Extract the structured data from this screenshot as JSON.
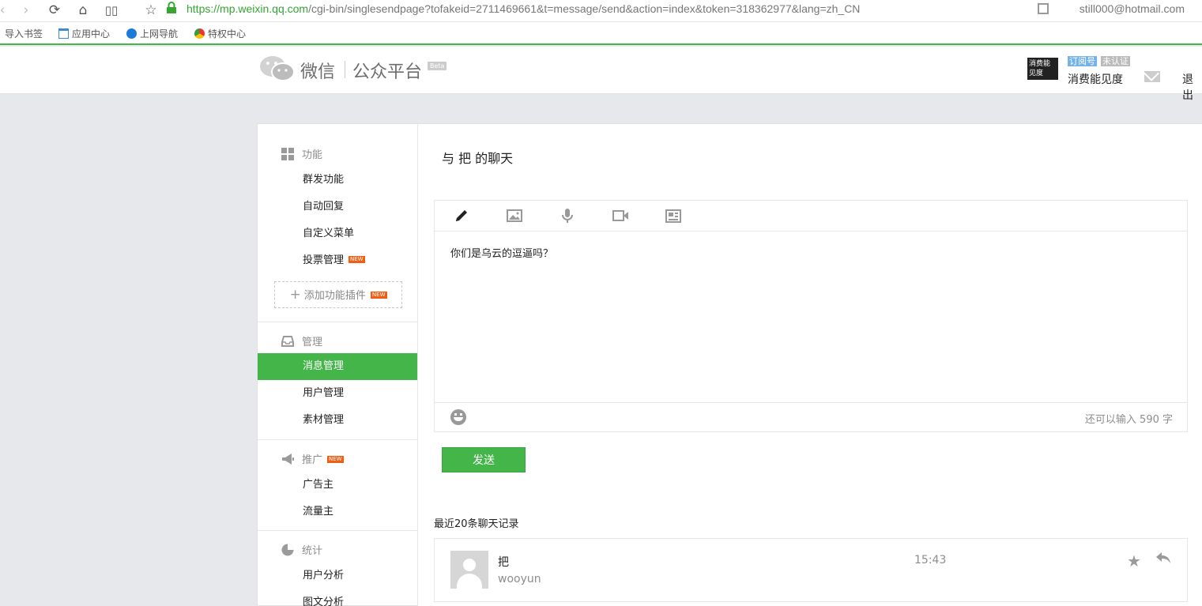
{
  "browser": {
    "url_https": "https://",
    "url_host": "mp.weixin.qq.com",
    "url_path": "/cgi-bin/singlesendpage?tofakeid=2711469661&t=message/send&action=index&token=318362977&lang=zh_CN",
    "account": "still000@hotmail.com",
    "bookmarks": [
      "导入书签",
      "应用中心",
      "上网导航",
      "特权中心"
    ]
  },
  "header": {
    "logo_text": "微信",
    "logo_sub": "公众平台",
    "beta": "Beta",
    "avatar_text": "消费能见度",
    "tag_type": "订阅号",
    "tag_status": "未认证",
    "account_name": "消费能见度",
    "logout": "退出"
  },
  "sidebar": {
    "features": {
      "title": "功能",
      "items": [
        "群发功能",
        "自动回复",
        "自定义菜单",
        "投票管理"
      ],
      "new_badge": "NEW",
      "add_plugin": "添加功能插件"
    },
    "manage": {
      "title": "管理",
      "items": [
        "消息管理",
        "用户管理",
        "素材管理"
      ]
    },
    "promote": {
      "title": "推广",
      "items": [
        "广告主",
        "流量主"
      ]
    },
    "stats": {
      "title": "统计",
      "items": [
        "用户分析",
        "图文分析"
      ]
    }
  },
  "main": {
    "chat_title": "与 把 的聊天",
    "tools": [
      "pencil-icon",
      "image-icon",
      "microphone-icon",
      "video-icon",
      "news-icon"
    ],
    "editor_text": "你们是乌云的逗逼吗？",
    "char_count": "还可以输入 590 字",
    "send_label": "发送",
    "history_title": "最近20条聊天记录",
    "history": [
      {
        "name": "把",
        "text": "wooyun",
        "time": "15:43"
      }
    ]
  },
  "colors": {
    "accent": "#44b549",
    "new_badge": "#f25d14",
    "tag_blue": "#73b3ea"
  }
}
